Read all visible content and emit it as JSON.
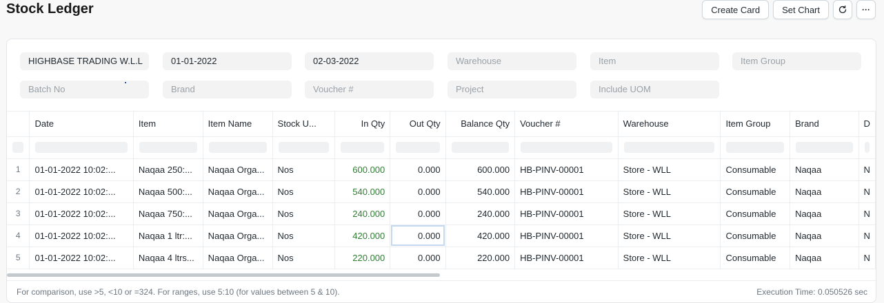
{
  "page": {
    "title": "Stock Ledger"
  },
  "toolbar": {
    "create_card": "Create Card",
    "set_chart": "Set Chart",
    "refresh_icon": "refresh-icon",
    "more_icon": "more-icon",
    "more_glyph": "···"
  },
  "filters": {
    "company": "HIGHBASE TRADING W.L.L",
    "from_date": "01-01-2022",
    "to_date": "02-03-2022",
    "warehouse_ph": "Warehouse",
    "item_ph": "Item",
    "item_group_ph": "Item Group",
    "batch_no_ph": "Batch No",
    "brand_ph": "Brand",
    "voucher_ph": "Voucher #",
    "project_ph": "Project",
    "include_uom_ph": "Include UOM"
  },
  "columns": [
    "Date",
    "Item",
    "Item Name",
    "Stock U...",
    "In Qty",
    "Out Qty",
    "Balance Qty",
    "Voucher #",
    "Warehouse",
    "Item Group",
    "Brand",
    "D"
  ],
  "rows": [
    {
      "no": "1",
      "date": "01-01-2022 10:02:...",
      "item": "Naqaa 250:...",
      "item_name": "Naqaa Orga...",
      "uom": "Nos",
      "in_qty": "600.000",
      "out_qty": "0.000",
      "balance": "600.000",
      "voucher": "HB-PINV-00001",
      "warehouse": "Store - WLL",
      "item_group": "Consumable",
      "brand": "Naqaa",
      "extra": "N"
    },
    {
      "no": "2",
      "date": "01-01-2022 10:02:...",
      "item": "Naqaa 500:...",
      "item_name": "Naqaa Orga...",
      "uom": "Nos",
      "in_qty": "540.000",
      "out_qty": "0.000",
      "balance": "540.000",
      "voucher": "HB-PINV-00001",
      "warehouse": "Store - WLL",
      "item_group": "Consumable",
      "brand": "Naqaa",
      "extra": "N"
    },
    {
      "no": "3",
      "date": "01-01-2022 10:02:...",
      "item": "Naqaa 750:...",
      "item_name": "Naqaa Orga...",
      "uom": "Nos",
      "in_qty": "240.000",
      "out_qty": "0.000",
      "balance": "240.000",
      "voucher": "HB-PINV-00001",
      "warehouse": "Store - WLL",
      "item_group": "Consumable",
      "brand": "Naqaa",
      "extra": "N"
    },
    {
      "no": "4",
      "date": "01-01-2022 10:02:...",
      "item": "Naqaa 1 ltr:...",
      "item_name": "Naqaa Orga...",
      "uom": "Nos",
      "in_qty": "420.000",
      "out_qty": "0.000",
      "balance": "420.000",
      "voucher": "HB-PINV-00001",
      "warehouse": "Store - WLL",
      "item_group": "Consumable",
      "brand": "Naqaa",
      "extra": "N"
    },
    {
      "no": "5",
      "date": "01-01-2022 10:02:...",
      "item": "Naqaa 4 ltrs...",
      "item_name": "Naqaa Orga...",
      "uom": "Nos",
      "in_qty": "220.000",
      "out_qty": "0.000",
      "balance": "220.000",
      "voucher": "HB-PINV-00001",
      "warehouse": "Store - WLL",
      "item_group": "Consumable",
      "brand": "Naqaa",
      "extra": "N"
    }
  ],
  "footer": {
    "hint": "For comparison, use >5, <10 or =324. For ranges, use 5:10 (for values between 5 & 10).",
    "exec": "Execution Time: 0.050526 sec"
  },
  "colors": {
    "in_qty": "#2e7d32",
    "selection": "#c5d8f1"
  }
}
